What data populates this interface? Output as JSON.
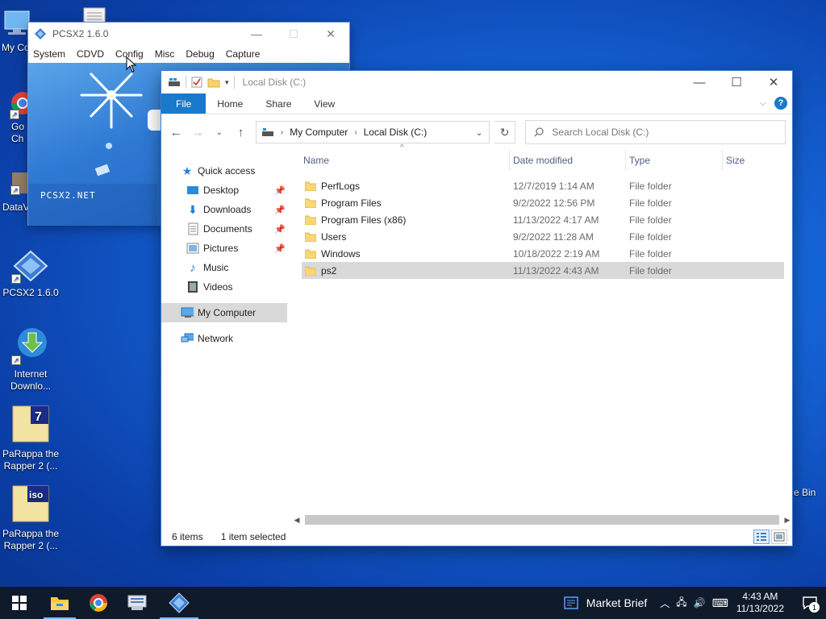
{
  "desktop": {
    "icons": [
      {
        "label": "My Co",
        "icon": "computer-icon"
      },
      {
        "label": "",
        "icon": "document-icon"
      },
      {
        "label": "Go Ch",
        "icon": "chrome-icon"
      },
      {
        "label": "DataV",
        "icon": "dataview-icon"
      },
      {
        "label": "PCSX2 1.6.0",
        "icon": "pcsx2-icon"
      },
      {
        "label": "Internet Downlo...",
        "icon": "idm-icon"
      },
      {
        "label": "PaRappa the Rapper 2 (...",
        "icon": "7z-archive-icon"
      },
      {
        "label": "PaRappa the Rapper 2 (...",
        "icon": "iso-file-icon"
      }
    ],
    "recycle_label": "e Bin"
  },
  "pcsx2": {
    "title": "PCSX2  1.6.0",
    "menu": [
      "System",
      "CDVD",
      "Config",
      "Misc",
      "Debug",
      "Capture"
    ],
    "splash_text": "PCSX2.NET"
  },
  "explorer": {
    "title": "Local Disk (C:)",
    "ribbon_tabs": [
      "File",
      "Home",
      "Share",
      "View"
    ],
    "breadcrumb": [
      "My Computer",
      "Local Disk (C:)"
    ],
    "search_placeholder": "Search Local Disk (C:)",
    "nav": {
      "quick_access": "Quick access",
      "items": [
        {
          "label": "Desktop",
          "icon": "desktop-icon",
          "pinned": true
        },
        {
          "label": "Downloads",
          "icon": "downloads-icon",
          "pinned": true
        },
        {
          "label": "Documents",
          "icon": "documents-icon",
          "pinned": true
        },
        {
          "label": "Pictures",
          "icon": "pictures-icon",
          "pinned": true
        },
        {
          "label": "Music",
          "icon": "music-icon",
          "pinned": false
        },
        {
          "label": "Videos",
          "icon": "videos-icon",
          "pinned": false
        }
      ],
      "my_computer": "My Computer",
      "network": "Network"
    },
    "columns": [
      "Name",
      "Date modified",
      "Type",
      "Size"
    ],
    "rows": [
      {
        "name": "PerfLogs",
        "date": "12/7/2019 1:14 AM",
        "type": "File folder"
      },
      {
        "name": "Program Files",
        "date": "9/2/2022 12:56 PM",
        "type": "File folder"
      },
      {
        "name": "Program Files (x86)",
        "date": "11/13/2022 4:17 AM",
        "type": "File folder"
      },
      {
        "name": "Users",
        "date": "9/2/2022 11:28 AM",
        "type": "File folder"
      },
      {
        "name": "Windows",
        "date": "10/18/2022 2:19 AM",
        "type": "File folder"
      },
      {
        "name": "ps2",
        "date": "11/13/2022 4:43 AM",
        "type": "File folder"
      }
    ],
    "status_items": "6 items",
    "status_selected": "1 item selected"
  },
  "taskbar": {
    "news": "Market Brief",
    "time": "4:43 AM",
    "date": "11/13/2022",
    "notifications": "1"
  },
  "colors": {
    "accent": "#1979ca",
    "selection": "#d9d9d9",
    "taskbar": "#0f1a2b"
  }
}
